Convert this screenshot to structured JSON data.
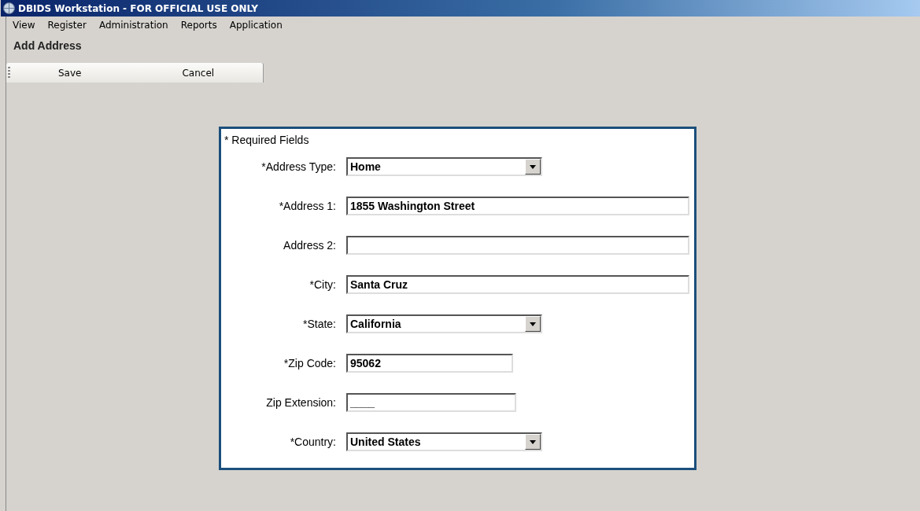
{
  "window": {
    "title": "DBIDS Workstation - FOR OFFICIAL USE ONLY"
  },
  "menu": [
    {
      "label": "View"
    },
    {
      "label": "Register"
    },
    {
      "label": "Administration"
    },
    {
      "label": "Reports"
    },
    {
      "label": "Application"
    }
  ],
  "page_title": "Add Address",
  "toolbar": [
    {
      "label": "Save"
    },
    {
      "label": "Cancel"
    }
  ],
  "form": {
    "note": "* Required Fields",
    "fields": [
      {
        "label": "*Address Type:",
        "kind": "select",
        "value": "Home"
      },
      {
        "label": "*Address 1:",
        "kind": "text",
        "value": "1855 Washington Street"
      },
      {
        "label": "Address 2:",
        "kind": "text"
      },
      {
        "label": "*City:",
        "kind": "text",
        "value": "Santa Cruz"
      },
      {
        "label": "*State:",
        "kind": "select",
        "value": "California"
      },
      {
        "label": "*Zip Code:",
        "kind": "text",
        "value": "95062"
      },
      {
        "label": "Zip Extension:",
        "kind": "text",
        "value": "____"
      },
      {
        "label": "*Country:",
        "kind": "select",
        "value": "United States"
      }
    ]
  }
}
